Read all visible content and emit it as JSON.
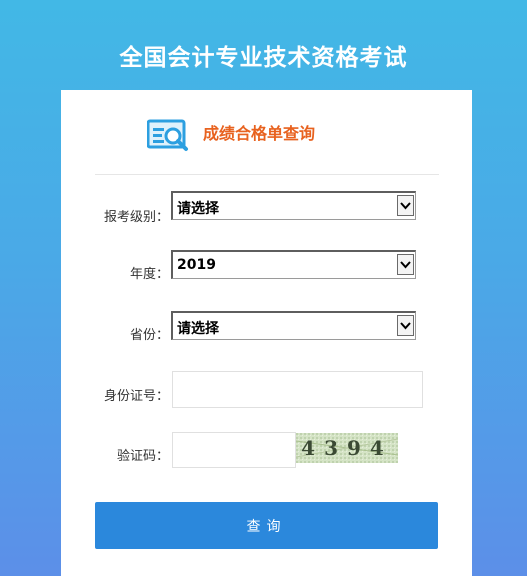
{
  "header": {
    "title": "全国会计专业技术资格考试"
  },
  "card": {
    "heading": "成绩合格单查询"
  },
  "form": {
    "level": {
      "label": "报考级别：",
      "selected": "请选择"
    },
    "year": {
      "label": "年度：",
      "selected": "2019"
    },
    "province": {
      "label": "省份：",
      "selected": "请选择"
    },
    "id_number": {
      "label": "身份证号：",
      "value": ""
    },
    "captcha": {
      "label": "验证码：",
      "value": "",
      "image_text": "4394"
    },
    "submit_label": "查询"
  },
  "colors": {
    "accent": "#2b88dc",
    "heading": "#e8621f",
    "background_top": "#42b8e6",
    "background_bottom": "#5c8fe8"
  },
  "icons": {
    "heading_icon": "query-document-icon",
    "dropdown_icon": "chevron-down-icon"
  }
}
